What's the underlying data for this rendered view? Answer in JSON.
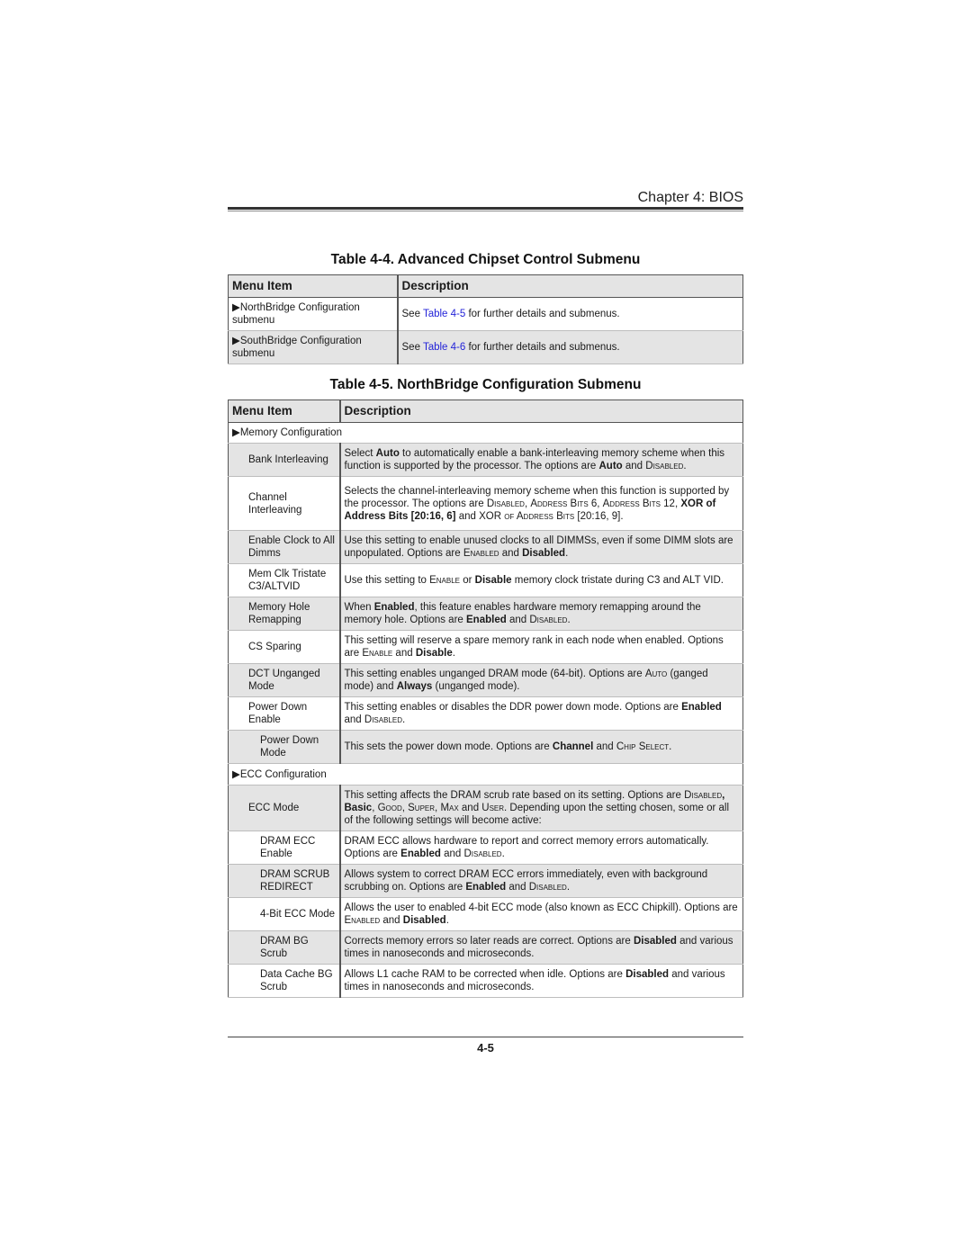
{
  "header": {
    "chapter": "Chapter 4: BIOS"
  },
  "table44": {
    "title": "Table 4-4. Advanced Chipset Control Submenu",
    "columns": [
      "Menu Item",
      "Description"
    ],
    "rows": [
      {
        "item": "▶NorthBridge Configuration submenu",
        "desc_pre": "See ",
        "link": "Table 4-5",
        "desc_post": " for further details and submenus."
      },
      {
        "item": "▶SouthBridge Configuration submenu",
        "desc_pre": "See ",
        "link": "Table 4-6",
        "desc_post": " for further details and submenus."
      }
    ]
  },
  "table45": {
    "title": "Table 4-5. NorthBridge Configuration Submenu",
    "columns": [
      "Menu Item",
      "Description"
    ],
    "sections": {
      "memory": "▶Memory Configuration",
      "ecc": "▶ECC Configuration"
    },
    "rows": [
      {
        "item": "Bank Interleaving",
        "desc": [
          [
            "t",
            "Select "
          ],
          [
            "b",
            "Auto"
          ],
          [
            "t",
            " to automatically enable a bank-interleaving memory scheme when this function is supported by the processor. The options are "
          ],
          [
            "b",
            "Auto"
          ],
          [
            "t",
            " and "
          ],
          [
            "s",
            "Disabled"
          ],
          [
            "t",
            "."
          ]
        ]
      },
      {
        "item": "Channel Interleaving",
        "desc": [
          [
            "t",
            "Selects the channel-interleaving memory scheme when this function is supported by the processor. The options are "
          ],
          [
            "s",
            "Disabled"
          ],
          [
            "t",
            ", "
          ],
          [
            "s",
            "Address Bits"
          ],
          [
            "t",
            " 6, "
          ],
          [
            "s",
            "Address Bits"
          ],
          [
            "t",
            " 12, "
          ],
          [
            "b",
            "XOR of Address Bits [20:16, 6]"
          ],
          [
            "t",
            " and XOR "
          ],
          [
            "s",
            "of Address Bits"
          ],
          [
            "t",
            " [20:16, 9]."
          ]
        ]
      },
      {
        "item": "Enable Clock to All Dimms",
        "desc": [
          [
            "t",
            "Use this setting to enable unused clocks to all DIMMSs, even if some DIMM slots are unpopulated. Options are "
          ],
          [
            "s",
            "Enabled"
          ],
          [
            "t",
            " and "
          ],
          [
            "b",
            "Disabled"
          ],
          [
            "t",
            "."
          ]
        ]
      },
      {
        "item": "Mem Clk Tristate C3/ALTVID",
        "desc": [
          [
            "t",
            "Use this setting to "
          ],
          [
            "s",
            "Enable"
          ],
          [
            "t",
            " or "
          ],
          [
            "b",
            "Disable"
          ],
          [
            "t",
            " memory clock tristate during C3 and ALT VID."
          ]
        ]
      },
      {
        "item": "Memory Hole Remapping",
        "desc": [
          [
            "t",
            "When "
          ],
          [
            "b",
            "Enabled"
          ],
          [
            "t",
            ", this feature enables hardware memory remapping around the memory hole. Options are "
          ],
          [
            "b",
            "Enabled"
          ],
          [
            "t",
            " and "
          ],
          [
            "s",
            "Disabled"
          ],
          [
            "t",
            "."
          ]
        ]
      },
      {
        "item": "CS Sparing",
        "desc": [
          [
            "t",
            "This setting will reserve a spare memory rank in each node when enabled. Options are "
          ],
          [
            "s",
            "Enable"
          ],
          [
            "t",
            " and "
          ],
          [
            "b",
            "Disable"
          ],
          [
            "t",
            "."
          ]
        ]
      },
      {
        "item": "DCT Unganged Mode",
        "desc": [
          [
            "t",
            "This setting enables unganged DRAM mode (64-bit). Options are "
          ],
          [
            "s",
            "Auto"
          ],
          [
            "t",
            " (ganged mode) and "
          ],
          [
            "b",
            "Always"
          ],
          [
            "t",
            " (unganged mode)."
          ]
        ]
      },
      {
        "item": "Power Down Enable",
        "desc": [
          [
            "t",
            "This setting enables or disables the DDR power down mode. Options are "
          ],
          [
            "b",
            "Enabled"
          ],
          [
            "t",
            " and "
          ],
          [
            "s",
            "Disabled"
          ],
          [
            "t",
            "."
          ]
        ]
      },
      {
        "item": "Power Down Mode",
        "desc": [
          [
            "t",
            "This sets the power down mode. Options are "
          ],
          [
            "b",
            "Channel"
          ],
          [
            "t",
            " and "
          ],
          [
            "s",
            "Chip Select"
          ],
          [
            "t",
            "."
          ]
        ]
      },
      {
        "item": "ECC Mode",
        "desc": [
          [
            "t",
            "This setting affects the DRAM scrub rate based on its setting. Options are "
          ],
          [
            "s",
            "Disabled"
          ],
          [
            "b",
            ", Basic"
          ],
          [
            "t",
            ", "
          ],
          [
            "s",
            "Good"
          ],
          [
            "t",
            ", "
          ],
          [
            "s",
            "Super"
          ],
          [
            "t",
            ", "
          ],
          [
            "s",
            "Max"
          ],
          [
            "t",
            " and "
          ],
          [
            "s",
            "User"
          ],
          [
            "t",
            ". Depending upon the setting chosen, some or all of the following settings will become active:"
          ]
        ]
      },
      {
        "item": "DRAM ECC Enable",
        "desc": [
          [
            "t",
            "DRAM ECC allows hardware to report and correct memory errors automatically. Options are "
          ],
          [
            "b",
            "Enabled"
          ],
          [
            "t",
            " and "
          ],
          [
            "s",
            "Disabled"
          ],
          [
            "t",
            "."
          ]
        ]
      },
      {
        "item": "DRAM SCRUB REDIRECT",
        "desc": [
          [
            "t",
            "Allows system to correct DRAM ECC errors immediately, even with background scrubbing on. Options are "
          ],
          [
            "b",
            "Enabled"
          ],
          [
            "t",
            " and "
          ],
          [
            "s",
            "Disabled"
          ],
          [
            "t",
            "."
          ]
        ]
      },
      {
        "item": "4-Bit ECC Mode",
        "desc": [
          [
            "t",
            "Allows the user to enabled 4-bit ECC mode (also known as ECC Chipkill). Options are "
          ],
          [
            "s",
            "Enabled"
          ],
          [
            "t",
            " and "
          ],
          [
            "b",
            "Disabled"
          ],
          [
            "t",
            "."
          ]
        ]
      },
      {
        "item": "DRAM BG Scrub",
        "desc": [
          [
            "t",
            "Corrects memory errors so later reads are correct. Options are "
          ],
          [
            "b",
            "Disabled"
          ],
          [
            "t",
            " and various times in nanoseconds and microseconds."
          ]
        ]
      },
      {
        "item": "Data Cache BG Scrub",
        "desc": [
          [
            "t",
            "Allows L1 cache RAM to be corrected when idle. Options are "
          ],
          [
            "b",
            "Disabled"
          ],
          [
            "t",
            " and various times in nanoseconds and microseconds."
          ]
        ]
      }
    ]
  },
  "footer": {
    "page_number": "4-5"
  }
}
